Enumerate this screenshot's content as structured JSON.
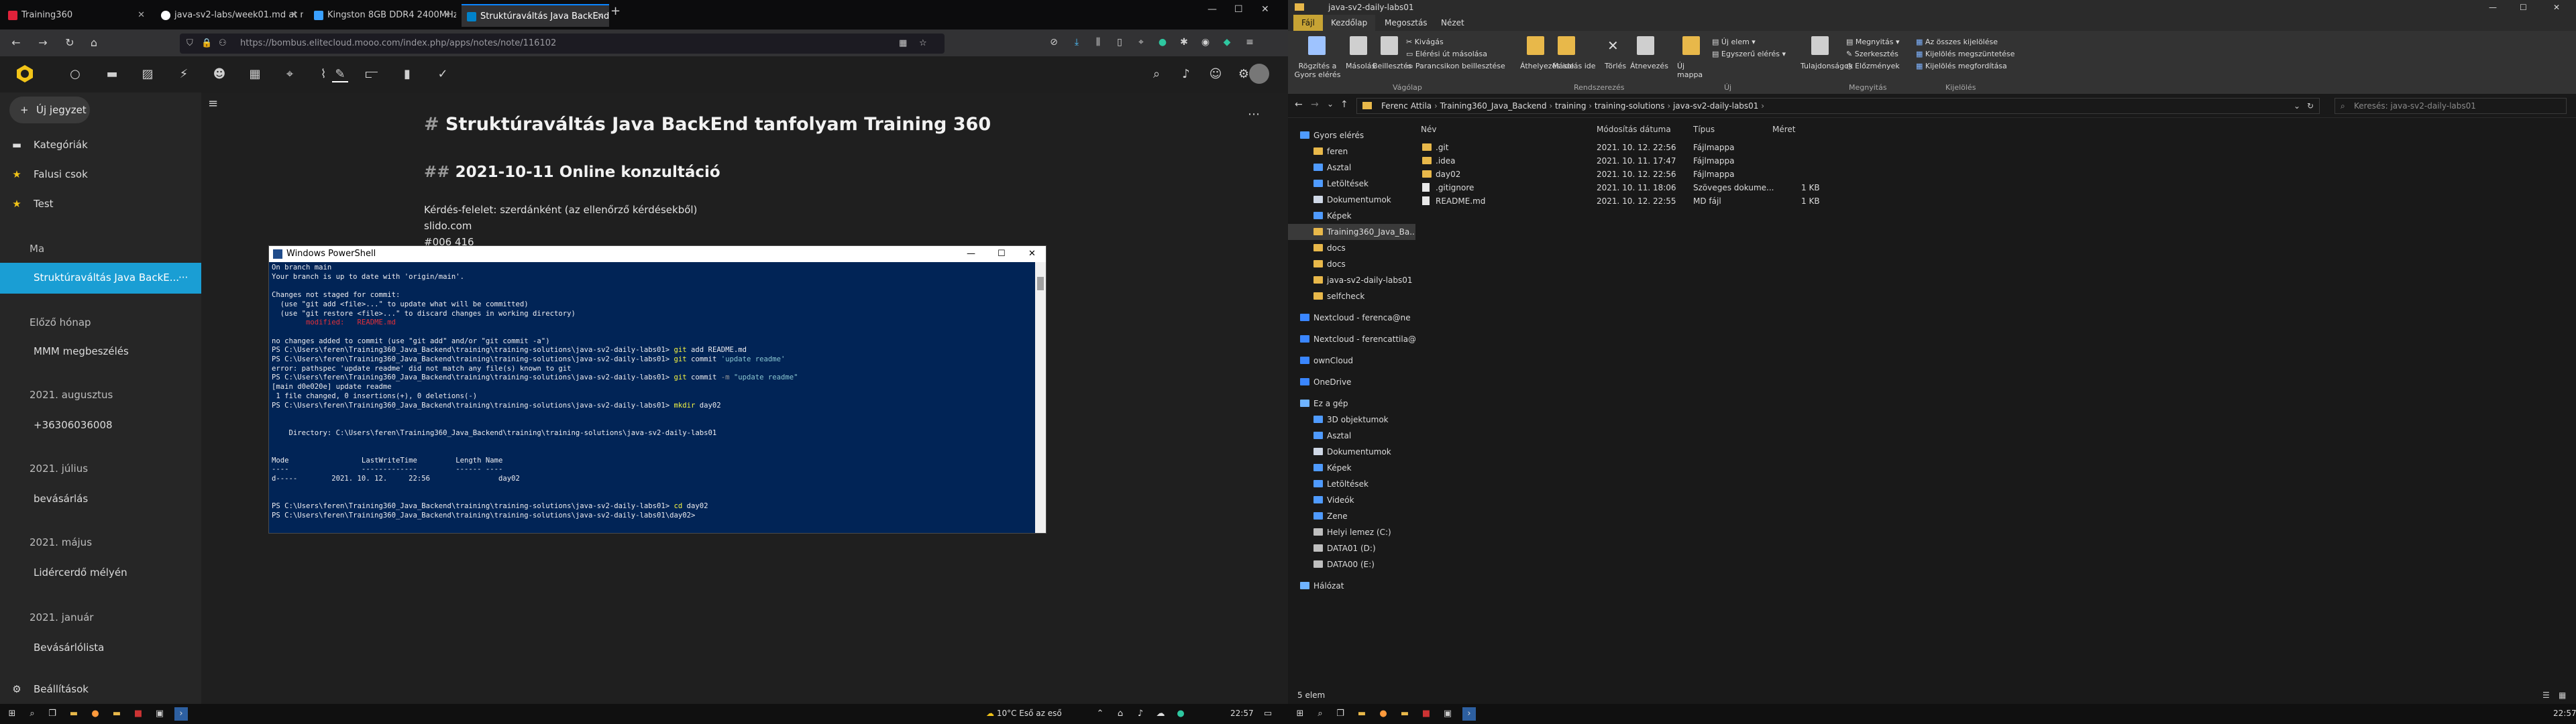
{
  "browser": {
    "tabs": [
      {
        "label": "Training360",
        "color": "#e0223a"
      },
      {
        "label": "java-sv2-labs/week01.md at m...",
        "color": "#ffffff"
      },
      {
        "label": "Kingston 8GB DDR4 2400MHz K...",
        "color": "#3aa0ff"
      },
      {
        "label": "Struktúraváltás Java BackEnd ta...",
        "color": "#0082c9"
      }
    ],
    "url": "https://bombus.elitecloud.mooo.com/index.php/apps/notes/note/116102",
    "new_tab": "+",
    "controls": {
      "min": "—",
      "max": "☐",
      "close": "✕"
    }
  },
  "notes_app": {
    "new_note": "Új jegyzet",
    "nav": [
      {
        "label": "Kategóriák"
      },
      {
        "label": "Falusi csok"
      },
      {
        "label": "Test"
      }
    ],
    "groups": [
      {
        "heading": "Ma",
        "items": [
          "Struktúraváltás Java BackE..."
        ]
      },
      {
        "heading": "Előző hónap",
        "items": [
          "MMM megbeszélés"
        ]
      },
      {
        "heading": "2021. augusztus",
        "items": [
          "+36306036008"
        ]
      },
      {
        "heading": "2021. július",
        "items": [
          "bevásárlás"
        ]
      },
      {
        "heading": "2021. május",
        "items": [
          "Lidércerdő mélyén"
        ]
      },
      {
        "heading": "2021. január",
        "items": [
          "Bevásárlólista"
        ]
      }
    ],
    "settings": "Beállítások",
    "active_more": "···",
    "note": {
      "title": "Struktúraváltás Java BackEnd tanfolyam Training 360",
      "subtitle": "2021-10-11 Online konzultáció",
      "lines": [
        "Kérdés-felelet: szerdánként (az ellenőrző kérdésekből)",
        "slido.com",
        "#006 416"
      ]
    }
  },
  "powershell": {
    "title": "Windows PowerShell",
    "lines": [
      {
        "t": "On branch main"
      },
      {
        "t": "Your branch is up to date with 'origin/main'."
      },
      {
        "t": ""
      },
      {
        "t": "Changes not staged for commit:"
      },
      {
        "t": "  (use \"git add <file>...\" to update what will be committed)"
      },
      {
        "t": "  (use \"git restore <file>...\" to discard changes in working directory)"
      },
      {
        "t": "        modified:   README.md",
        "c": "r"
      },
      {
        "t": ""
      },
      {
        "t": "no changes added to commit (use \"git add\" and/or \"git commit -a\")"
      },
      {
        "t": "PS C:\\Users\\feren\\Training360_Java_Backend\\training\\training-solutions\\java-sv2-daily-labs01> ",
        "cmd": "git",
        "arg": " add README.md"
      },
      {
        "t": "PS C:\\Users\\feren\\Training360_Java_Backend\\training\\training-solutions\\java-sv2-daily-labs01> ",
        "cmd": "git",
        "arg": " commit ",
        "str": "'update readme'"
      },
      {
        "t": "error: pathspec 'update readme' did not match any file(s) known to git"
      },
      {
        "t": "PS C:\\Users\\feren\\Training360_Java_Backend\\training\\training-solutions\\java-sv2-daily-labs01> ",
        "cmd": "git",
        "arg": " commit ",
        "flag": "-m",
        "str": " \"update readme\""
      },
      {
        "t": "[main d0e020e] update readme"
      },
      {
        "t": " 1 file changed, 0 insertions(+), 0 deletions(-)"
      },
      {
        "t": "PS C:\\Users\\feren\\Training360_Java_Backend\\training\\training-solutions\\java-sv2-daily-labs01> ",
        "cmd": "mkdir",
        "arg": " day02"
      },
      {
        "t": ""
      },
      {
        "t": ""
      },
      {
        "t": "    Directory: C:\\Users\\feren\\Training360_Java_Backend\\training\\training-solutions\\java-sv2-daily-labs01"
      },
      {
        "t": ""
      },
      {
        "t": ""
      },
      {
        "t": "Mode                 LastWriteTime         Length Name"
      },
      {
        "t": "----                 -------------         ------ ----"
      },
      {
        "t": "d-----        2021. 10. 12.     22:56                day02"
      },
      {
        "t": ""
      },
      {
        "t": ""
      },
      {
        "t": "PS C:\\Users\\feren\\Training360_Java_Backend\\training\\training-solutions\\java-sv2-daily-labs01> ",
        "cmd": "cd",
        "arg": " day02"
      },
      {
        "t": "PS C:\\Users\\feren\\Training360_Java_Backend\\training\\training-solutions\\java-sv2-daily-labs01\\day02>"
      }
    ]
  },
  "taskbar_left": {
    "weather": "10°C  Eső az eső",
    "time": "22:57"
  },
  "explorer": {
    "window_title": "java-sv2-daily-labs01",
    "tabs": [
      "Fájl",
      "Kezdőlap",
      "Megosztás",
      "Nézet"
    ],
    "ribbon": {
      "pin": "Rögzítés a Gyors elérés",
      "copy": "Másolás",
      "paste": "Beillesztés",
      "cut": "Kivágás",
      "copy_path": "Elérési út másolása",
      "paste_shortcut": "Parancsikon beillesztése",
      "move": "Áthelyezés ide",
      "copy_to": "Másolás ide",
      "delete": "Törlés",
      "rename": "Átnevezés",
      "new_folder": "Új mappa",
      "new_item": "Új elem",
      "easy_access": "Egyszerű elérés",
      "properties": "Tulajdonságok",
      "open": "Megnyitás",
      "edit": "Szerkesztés",
      "history": "Előzmények",
      "select_all": "Az összes kijelölése",
      "select_none": "Kijelölés megszüntetése",
      "invert": "Kijelölés megfordítása",
      "groups": [
        "Vágólap",
        "Rendszerezés",
        "Új",
        "Megnyitás",
        "Kijelölés"
      ]
    },
    "breadcrumb": [
      "Ferenc Attila",
      "Training360_Java_Backend",
      "training",
      "training-solutions",
      "java-sv2-daily-labs01"
    ],
    "search_placeholder": "Keresés: java-sv2-daily-labs01",
    "nav": [
      {
        "label": "Gyors elérés",
        "type": "star"
      },
      {
        "label": "feren",
        "type": "folder"
      },
      {
        "label": "Asztal",
        "type": "blue"
      },
      {
        "label": "Letöltések",
        "type": "blue"
      },
      {
        "label": "Dokumentumok",
        "type": "doc"
      },
      {
        "label": "Képek",
        "type": "blue"
      },
      {
        "label": "Training360_Java_Ba...",
        "type": "folder",
        "sel": true
      },
      {
        "label": "docs",
        "type": "folder"
      },
      {
        "label": "docs",
        "type": "folder"
      },
      {
        "label": "java-sv2-daily-labs01",
        "type": "folder"
      },
      {
        "label": "selfcheck",
        "type": "folder"
      },
      {
        "label": "",
        "type": "gap"
      },
      {
        "label": "Nextcloud - ferenca@ne",
        "type": "cloud"
      },
      {
        "label": "",
        "type": "gap"
      },
      {
        "label": "Nextcloud - ferencattila@",
        "type": "cloud"
      },
      {
        "label": "",
        "type": "gap"
      },
      {
        "label": "ownCloud",
        "type": "cloud"
      },
      {
        "label": "",
        "type": "gap"
      },
      {
        "label": "OneDrive",
        "type": "cloud"
      },
      {
        "label": "",
        "type": "gap"
      },
      {
        "label": "Ez a gép",
        "type": "pc"
      },
      {
        "label": "3D objektumok",
        "type": "blue"
      },
      {
        "label": "Asztal",
        "type": "blue"
      },
      {
        "label": "Dokumentumok",
        "type": "doc"
      },
      {
        "label": "Képek",
        "type": "blue"
      },
      {
        "label": "Letöltések",
        "type": "blue"
      },
      {
        "label": "Videók",
        "type": "blue"
      },
      {
        "label": "Zene",
        "type": "blue"
      },
      {
        "label": "Helyi lemez (C:)",
        "type": "drive"
      },
      {
        "label": "DATA01 (D:)",
        "type": "drive"
      },
      {
        "label": "DATA00 (E:)",
        "type": "drive"
      },
      {
        "label": "",
        "type": "gap"
      },
      {
        "label": "Hálózat",
        "type": "net"
      }
    ],
    "columns": [
      "Név",
      "Módosítás dátuma",
      "Típus",
      "Méret"
    ],
    "files": [
      {
        "name": ".git",
        "date": "2021. 10. 12. 22:56",
        "type": "Fájlmappa",
        "size": "",
        "kind": "folder"
      },
      {
        "name": ".idea",
        "date": "2021. 10. 11. 17:47",
        "type": "Fájlmappa",
        "size": "",
        "kind": "folder"
      },
      {
        "name": "day02",
        "date": "2021. 10. 12. 22:56",
        "type": "Fájlmappa",
        "size": "",
        "kind": "folder"
      },
      {
        "name": ".gitignore",
        "date": "2021. 10. 11. 18:06",
        "type": "Szöveges dokume...",
        "size": "1 KB",
        "kind": "file"
      },
      {
        "name": "README.md",
        "date": "2021. 10. 12. 22:55",
        "type": "MD fájl",
        "size": "1 KB",
        "kind": "file"
      }
    ],
    "status": "5 elem",
    "clock": "22:57"
  }
}
